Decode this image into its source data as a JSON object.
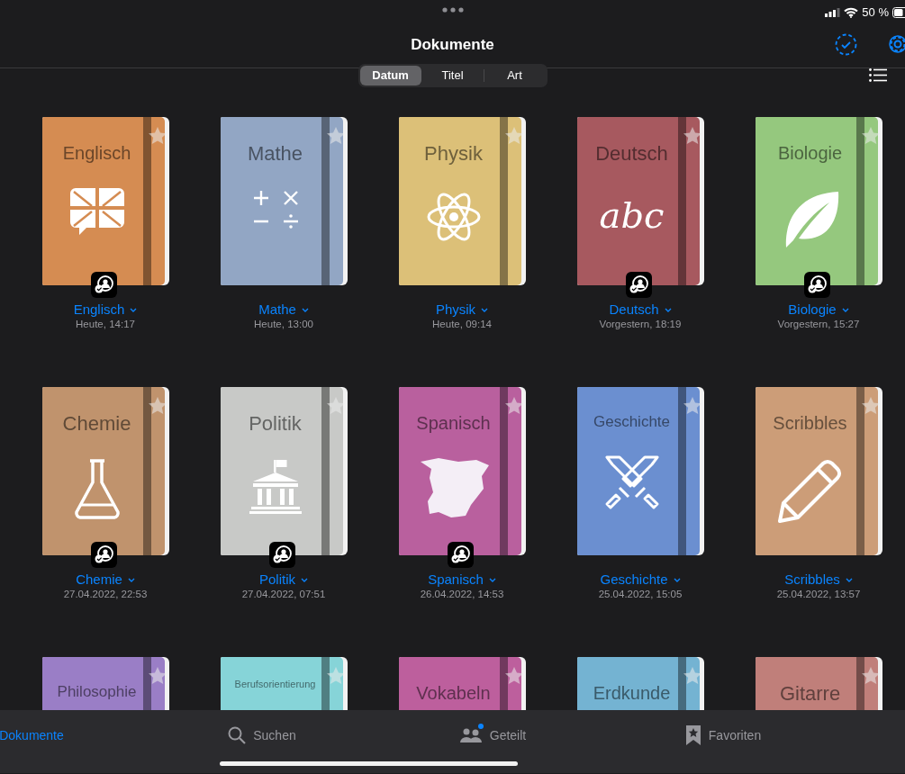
{
  "status_bar": {
    "battery_text": "50 %"
  },
  "nav": {
    "title": "Dokumente"
  },
  "sort_segments": [
    {
      "label": "Datum",
      "selected": true
    },
    {
      "label": "Titel",
      "selected": false
    },
    {
      "label": "Art",
      "selected": false
    }
  ],
  "notebooks": [
    {
      "cover_title": "Englisch",
      "color": "#d58c52",
      "kind": "flag-bubble",
      "shared": true,
      "name": "Englisch",
      "date": "Heute, 14:17"
    },
    {
      "cover_title": "Mathe",
      "color": "#92a6c4",
      "kind": "math",
      "shared": false,
      "name": "Mathe",
      "date": "Heute, 13:00"
    },
    {
      "cover_title": "Physik",
      "color": "#dcc078",
      "kind": "atom",
      "shared": false,
      "name": "Physik",
      "date": "Heute, 09:14"
    },
    {
      "cover_title": "Deutsch",
      "color": "#a7595f",
      "kind": "text",
      "icon_text": "abc",
      "shared": true,
      "name": "Deutsch",
      "date": "Vorgestern, 18:19"
    },
    {
      "cover_title": "Biologie",
      "color": "#95c87e",
      "kind": "leaf",
      "shared": true,
      "name": "Biologie",
      "date": "Vorgestern, 15:27"
    },
    {
      "cover_title": "Chemie",
      "color": "#c0936d",
      "kind": "flask",
      "shared": true,
      "name": "Chemie",
      "date": "27.04.2022, 22:53"
    },
    {
      "cover_title": "Politik",
      "color": "#c8c9c7",
      "kind": "building",
      "shared": true,
      "name": "Politik",
      "date": "27.04.2022, 07:51"
    },
    {
      "cover_title": "Spanisch",
      "color": "#b9609e",
      "kind": "map",
      "shared": true,
      "name": "Spanisch",
      "date": "26.04.2022, 14:53"
    },
    {
      "cover_title": "Geschichte",
      "color": "#6b8fd0",
      "kind": "swords",
      "shared": false,
      "name": "Geschichte",
      "date": "25.04.2022, 15:05"
    },
    {
      "cover_title": "Scribbles",
      "color": "#cc9d78",
      "kind": "pencil",
      "shared": false,
      "name": "Scribbles",
      "date": "25.04.2022, 13:57"
    },
    {
      "cover_title": "Philosophie",
      "color": "#9a7ec6"
    },
    {
      "cover_title": "Berufsorientierung",
      "color": "#86d4d8"
    },
    {
      "cover_title": "Vokabeln",
      "color": "#bd5f9d"
    },
    {
      "cover_title": "Erdkunde",
      "color": "#74b3d2"
    },
    {
      "cover_title": "Gitarre",
      "color": "#c07f7a"
    }
  ],
  "tab_bar": [
    {
      "label": "Dokumente",
      "selected": true
    },
    {
      "label": "Suchen",
      "selected": false,
      "kind": "search"
    },
    {
      "label": "Geteilt",
      "selected": false,
      "kind": "people",
      "notification": true
    },
    {
      "label": "Favoriten",
      "selected": false,
      "kind": "bookmark-star"
    }
  ]
}
